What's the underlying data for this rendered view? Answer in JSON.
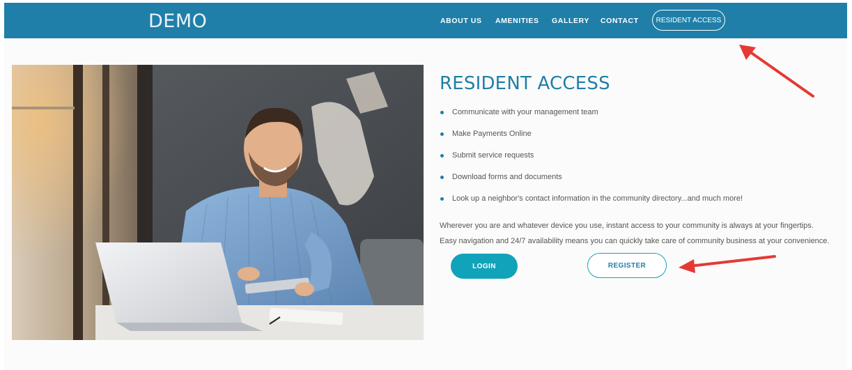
{
  "header": {
    "logo": "DEMO",
    "nav": [
      {
        "label": "ABOUT US"
      },
      {
        "label": "AMENITIES"
      },
      {
        "label": "GALLERY"
      },
      {
        "label": "CONTACT"
      }
    ],
    "resident_access_label": "RESIDENT ACCESS"
  },
  "main": {
    "title": "RESIDENT ACCESS",
    "features": [
      "Communicate with your management team",
      "Make Payments Online",
      "Submit service requests",
      "Download forms and documents",
      "Look up a neighbor's contact information in the community directory...and much more!"
    ],
    "paragraph_line1": "Wherever you are and whatever device you use, instant access to your community is always at your fingertips.",
    "paragraph_line2": "Easy navigation and 24/7 availability means you can quickly take care of community business at your convenience.",
    "login_label": "LOGIN",
    "register_label": "REGISTER"
  },
  "colors": {
    "header_bg": "#1f7fa8",
    "accent_teal": "#11a3b9",
    "title_blue": "#1f7fa8",
    "annotation_arrow": "#e53935"
  }
}
